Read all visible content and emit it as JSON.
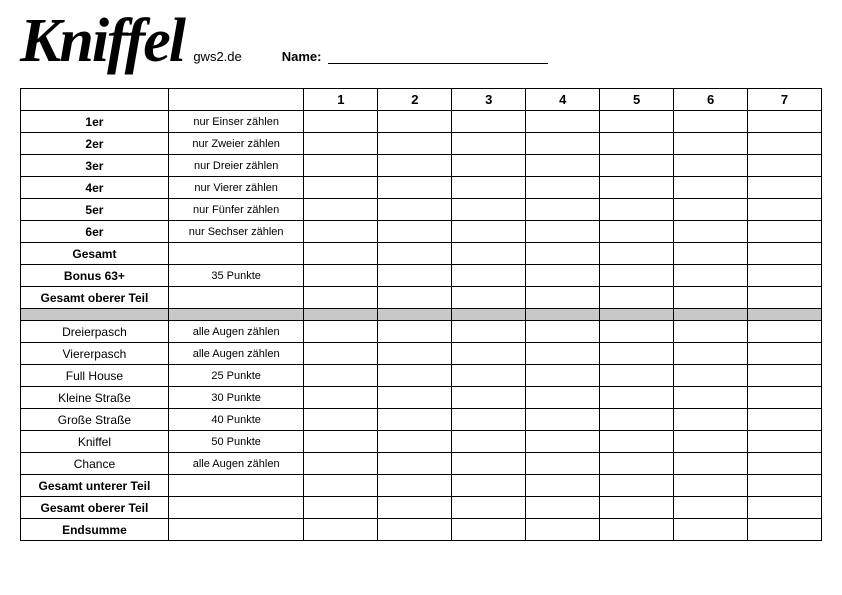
{
  "header": {
    "title": "Kniffel",
    "subtitle": "gws2.de",
    "name_label": "Name:"
  },
  "columns": [
    "1",
    "2",
    "3",
    "4",
    "5",
    "6",
    "7"
  ],
  "upper_section": [
    {
      "label": "1er",
      "desc": "nur Einser zählen",
      "bold": true
    },
    {
      "label": "2er",
      "desc": "nur Zweier zählen",
      "bold": true
    },
    {
      "label": "3er",
      "desc": "nur Dreier zählen",
      "bold": true
    },
    {
      "label": "4er",
      "desc": "nur Vierer zählen",
      "bold": true
    },
    {
      "label": "5er",
      "desc": "nur Fünfer zählen",
      "bold": true
    },
    {
      "label": "6er",
      "desc": "nur Sechser zählen",
      "bold": true
    },
    {
      "label": "Gesamt",
      "desc": "",
      "bold": true
    },
    {
      "label": "Bonus 63+",
      "desc": "35 Punkte",
      "bold": true
    },
    {
      "label": "Gesamt oberer Teil",
      "desc": "",
      "bold": true
    }
  ],
  "lower_section": [
    {
      "label": "Dreierpasch",
      "desc": "alle Augen zählen",
      "bold": false
    },
    {
      "label": "Viererpasch",
      "desc": "alle Augen zählen",
      "bold": false
    },
    {
      "label": "Full House",
      "desc": "25 Punkte",
      "bold": false
    },
    {
      "label": "Kleine Straße",
      "desc": "30 Punkte",
      "bold": false
    },
    {
      "label": "Große Straße",
      "desc": "40 Punkte",
      "bold": false
    },
    {
      "label": "Kniffel",
      "desc": "50 Punkte",
      "bold": false
    },
    {
      "label": "Chance",
      "desc": "alle Augen zählen",
      "bold": false
    },
    {
      "label": "Gesamt unterer Teil",
      "desc": "",
      "bold": true
    },
    {
      "label": "Gesamt oberer Teil",
      "desc": "",
      "bold": true
    },
    {
      "label": "Endsumme",
      "desc": "",
      "bold": true
    }
  ]
}
